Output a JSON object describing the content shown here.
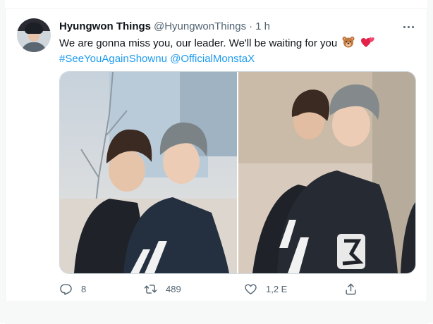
{
  "tweet": {
    "author_name": "Hyungwon Things",
    "author_handle": "@HyungwonThings",
    "separator": "·",
    "time": "1 h",
    "text_line1": "We are gonna miss you, our leader. We'll be waiting for you",
    "hashtag": "#SeeYouAgainShownu",
    "mention": "@OfficialMonstaX",
    "emojis": [
      "bear-face",
      "two-hearts"
    ],
    "link_color": "#1d9bf0"
  },
  "actions": {
    "reply_count": "8",
    "retweet_count": "489",
    "like_count": "1,2 E",
    "icons": [
      "reply-icon",
      "retweet-icon",
      "like-icon",
      "share-icon"
    ]
  },
  "colors": {
    "text_primary": "#0f1419",
    "text_secondary": "#536471",
    "border": "#cfd9de"
  }
}
